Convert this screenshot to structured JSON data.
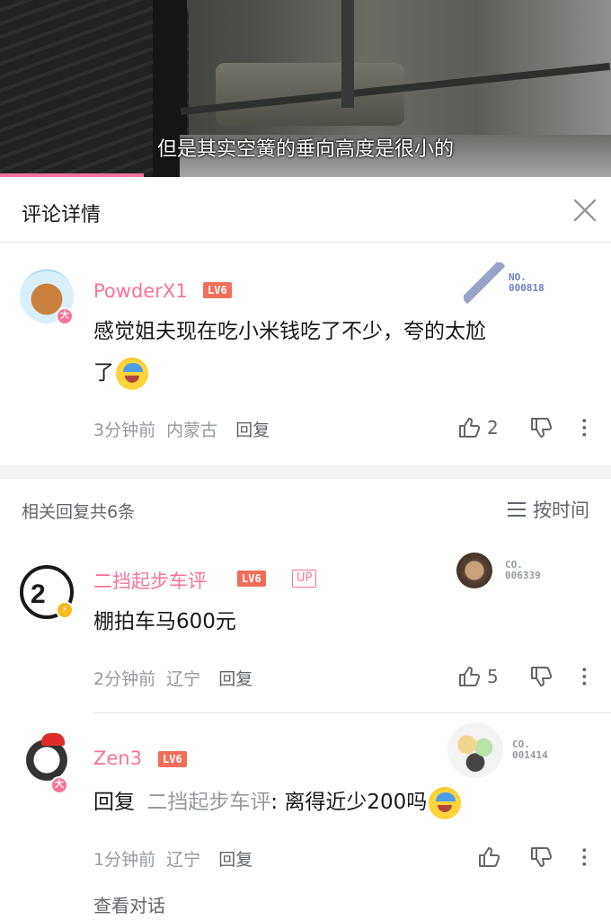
{
  "video": {
    "subtitle": "但是其实空簧的垂向高度是很小的",
    "progress_fraction": 0.235
  },
  "header": {
    "title": "评论详情"
  },
  "main_comment": {
    "username": "PowderX1",
    "level": "LV6",
    "badge_char": "大",
    "fan_no_top": "NO.",
    "fan_no_bottom": "000818",
    "text_line1": "感觉姐夫现在吃小米钱吃了不少，夸的太尬",
    "text_line2": "了",
    "time": "3分钟前",
    "location": "内蒙古",
    "reply_label": "回复",
    "likes": "2"
  },
  "replies_section": {
    "title": "相关回复共6条",
    "sort_label": "按时间"
  },
  "replies": [
    {
      "username": "二挡起步车评",
      "level": "LV6",
      "up_tag": "UP",
      "fan_no_top": "CO.",
      "fan_no_bottom": "006339",
      "text": "棚拍车马600元",
      "time": "2分钟前",
      "location": "辽宁",
      "reply_label": "回复",
      "likes": "5"
    },
    {
      "username": "Zen3",
      "level": "LV6",
      "badge_char": "大",
      "fan_no_top": "CO.",
      "fan_no_bottom": "001414",
      "reply_prefix": "回复",
      "reply_target": "二挡起步车评",
      "text": ": 离得近少200吗",
      "time": "1分钟前",
      "location": "辽宁",
      "reply_label": "回复",
      "likes": ""
    }
  ],
  "view_conversation": "查看对话",
  "colors": {
    "accent_pink": "#fb7299",
    "level_red": "#f26d5b",
    "text_gray": "#9499a0",
    "divider": "#f1f2f3"
  },
  "icons": [
    "close-icon",
    "thumb-up-icon",
    "thumb-down-icon",
    "more-icon",
    "sort-icon",
    "emoji-icon"
  ]
}
